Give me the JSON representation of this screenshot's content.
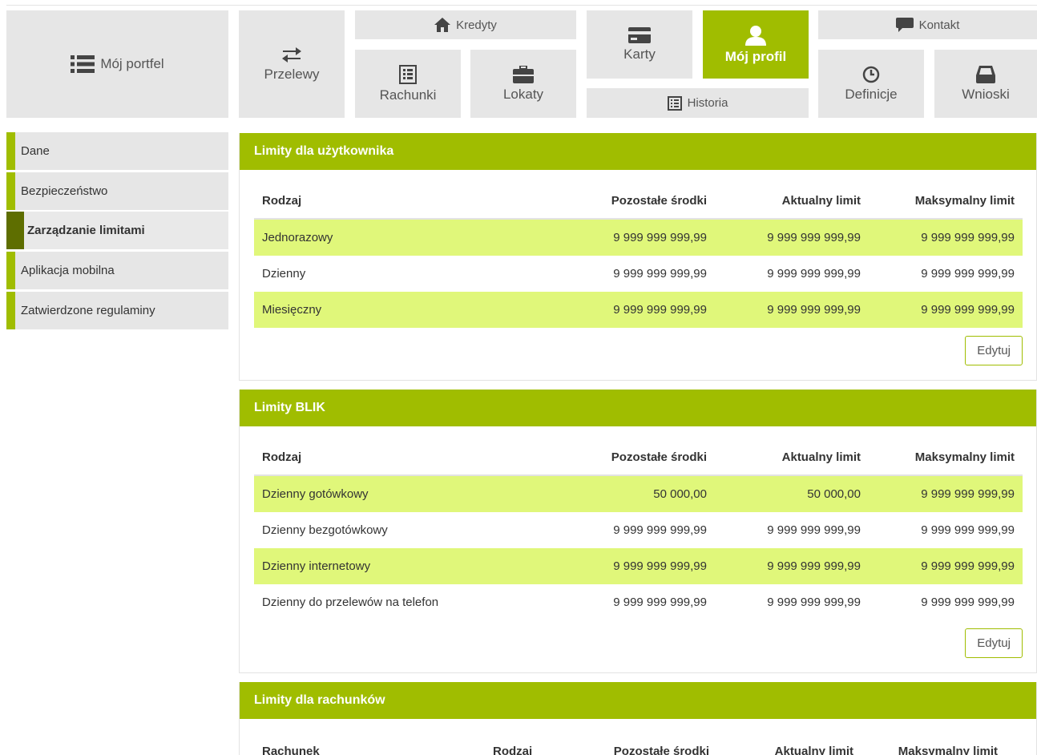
{
  "nav": {
    "portfel": "Mój portfel",
    "przelewy": "Przelewy",
    "kredyty": "Kredyty",
    "rachunki": "Rachunki",
    "lokaty": "Lokaty",
    "karty": "Karty",
    "historia": "Historia",
    "moj_profil": "Mój profil",
    "kontakt": "Kontakt",
    "definicje": "Definicje",
    "wnioski": "Wnioski"
  },
  "sidebar": {
    "items": [
      {
        "label": "Dane"
      },
      {
        "label": "Bezpieczeństwo"
      },
      {
        "label": "Zarządzanie limitami"
      },
      {
        "label": "Aplikacja mobilna"
      },
      {
        "label": "Zatwierdzone regulaminy"
      }
    ]
  },
  "panels": {
    "user": {
      "title": "Limity dla użytkownika",
      "headers": [
        "Rodzaj",
        "Pozostałe środki",
        "Aktualny limit",
        "Maksymalny limit"
      ],
      "rows": [
        [
          "Jednorazowy",
          "9 999 999 999,99",
          "9 999 999 999,99",
          "9 999 999 999,99"
        ],
        [
          "Dzienny",
          "9 999 999 999,99",
          "9 999 999 999,99",
          "9 999 999 999,99"
        ],
        [
          "Miesięczny",
          "9 999 999 999,99",
          "9 999 999 999,99",
          "9 999 999 999,99"
        ]
      ],
      "button": "Edytuj"
    },
    "blik": {
      "title": "Limity BLIK",
      "headers": [
        "Rodzaj",
        "Pozostałe środki",
        "Aktualny limit",
        "Maksymalny limit"
      ],
      "rows": [
        [
          "Dzienny gotówkowy",
          "50 000,00",
          "50 000,00",
          "9 999 999 999,99"
        ],
        [
          "Dzienny bezgotówkowy",
          "9 999 999 999,99",
          "9 999 999 999,99",
          "9 999 999 999,99"
        ],
        [
          "Dzienny internetowy",
          "9 999 999 999,99",
          "9 999 999 999,99",
          "9 999 999 999,99"
        ],
        [
          "Dzienny do przelewów na telefon",
          "9 999 999 999,99",
          "9 999 999 999,99",
          "9 999 999 999,99"
        ]
      ],
      "button": "Edytuj"
    },
    "accounts": {
      "title": "Limity dla rachunków",
      "headers": [
        "Rachunek",
        "Rodzaj",
        "Pozostałe środki",
        "Aktualny limit",
        "Maksymalny limit"
      ]
    }
  },
  "colors": {
    "accent": "#a0bd00",
    "active_dark": "#5e6e00",
    "row_highlight": "#e0f77a",
    "tile_bg": "#e6e6e6"
  }
}
